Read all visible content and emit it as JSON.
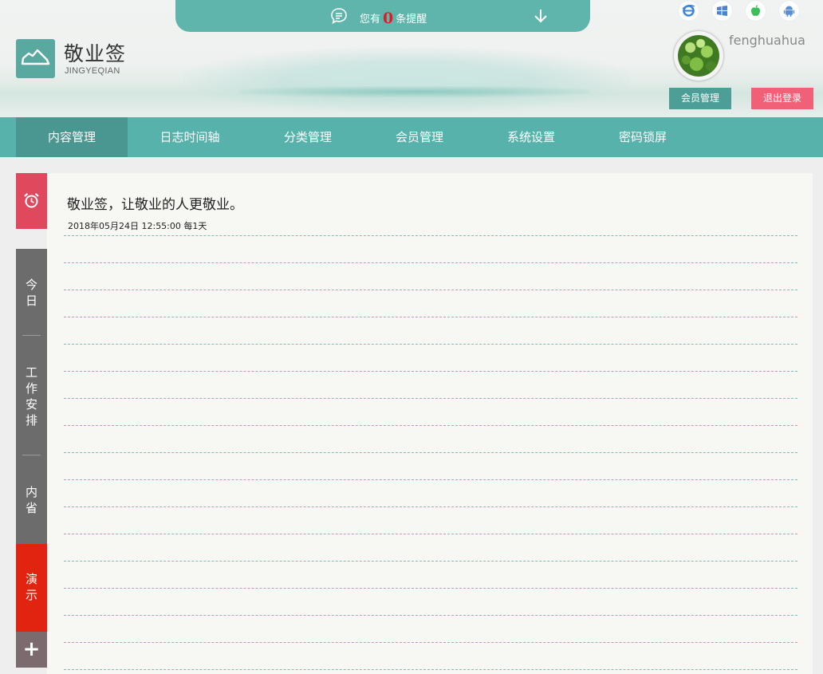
{
  "header": {
    "notice_prefix": "您有",
    "notice_count": "0",
    "notice_suffix": "条提醒",
    "brand_name": "敬业签",
    "brand_sub": "JINGYEQIAN",
    "username": "fenghuahua",
    "member_button": "会员管理",
    "logout_button": "退出登录",
    "platform_icons": [
      "ie-icon",
      "windows-icon",
      "apple-icon",
      "android-icon"
    ]
  },
  "nav": {
    "items": [
      {
        "label": "内容管理",
        "active": true
      },
      {
        "label": "日志时间轴",
        "active": false
      },
      {
        "label": "分类管理",
        "active": false
      },
      {
        "label": "会员管理",
        "active": false
      },
      {
        "label": "系统设置",
        "active": false
      },
      {
        "label": "密码锁屏",
        "active": false
      }
    ]
  },
  "sidebar": {
    "alarm_icon": "alarm-clock-icon",
    "tabs": [
      {
        "label": "今日"
      },
      {
        "label": "工作安排"
      },
      {
        "label": "内省"
      },
      {
        "label": "演示"
      }
    ],
    "add_label": "+"
  },
  "note": {
    "title": "敬业签，让敬业的人更敬业。",
    "meta": "2018年05月24日 12:55:00 每1天"
  },
  "colors": {
    "accent": "#58b2ac",
    "nav_active": "#4a9691",
    "alarm_tab": "#e0485e",
    "demo_tab": "#e1240f",
    "logout": "#f06077",
    "count": "#d8202a"
  }
}
